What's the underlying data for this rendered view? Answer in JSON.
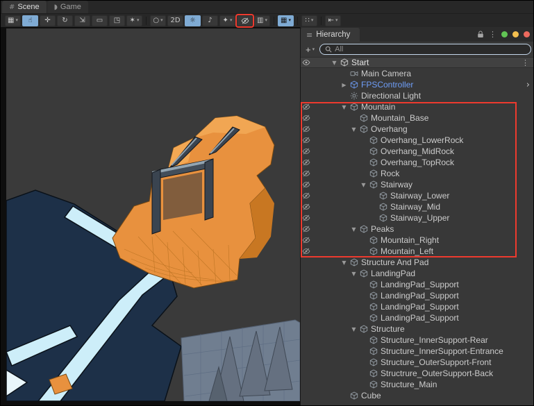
{
  "tabs": [
    {
      "label": "Scene",
      "active": true
    },
    {
      "label": "Game",
      "active": false
    }
  ],
  "scene_toolbar": {
    "buttons": [
      {
        "name": "tool-settings-button",
        "glyph": "▦",
        "dropdown": true
      },
      {
        "name": "view-hand-tool-button",
        "glyph": "☝",
        "active": true
      },
      {
        "name": "move-tool-button",
        "glyph": "✛"
      },
      {
        "name": "rotate-tool-button",
        "glyph": "↻"
      },
      {
        "name": "scale-tool-button",
        "glyph": "⇲"
      },
      {
        "name": "rect-tool-button",
        "glyph": "▭"
      },
      {
        "name": "transform-tool-button",
        "glyph": "◳"
      },
      {
        "name": "custom-tool-button",
        "glyph": "✶",
        "dropdown": true
      },
      {
        "type": "separator"
      },
      {
        "name": "draw-mode-button",
        "glyph": "○",
        "dropdown": true
      },
      {
        "name": "2d-toggle-button",
        "glyph": "2D"
      },
      {
        "name": "lighting-toggle-button",
        "glyph": "☼",
        "active": true
      },
      {
        "name": "audio-toggle-button",
        "glyph": "♪"
      },
      {
        "name": "effects-button",
        "glyph": "✦",
        "dropdown": true
      },
      {
        "name": "scene-visibility-button",
        "icon": "eye-off-icon",
        "red_box": true
      },
      {
        "name": "camera-view-button",
        "glyph": "▥",
        "dropdown": true
      },
      {
        "type": "separator"
      },
      {
        "name": "grid-visibility-button",
        "glyph": "▦",
        "dropdown": true,
        "active": true
      },
      {
        "type": "separator"
      },
      {
        "name": "snap-settings-button",
        "glyph": "∷",
        "dropdown": true
      },
      {
        "type": "separator"
      },
      {
        "name": "overlay-nav-button",
        "glyph": "⇤",
        "dropdown": true
      }
    ]
  },
  "hierarchy": {
    "tab_label": "Hierarchy",
    "add_button_label": "+",
    "search": {
      "placeholder": "All"
    },
    "rows": [
      {
        "label": "Start",
        "level": 0,
        "fold": "open",
        "icon": "unity-scene",
        "eye": true,
        "kebab": true,
        "header": true
      },
      {
        "label": "Main Camera",
        "level": 1,
        "icon": "camera"
      },
      {
        "label": "FPSController",
        "level": 1,
        "fold": "closed",
        "icon": "prefab-cube",
        "prefab": true,
        "expand_arrow": true
      },
      {
        "label": "Directional Light",
        "level": 1,
        "icon": "light"
      },
      {
        "label": "Mountain",
        "level": 1,
        "fold": "open",
        "icon": "cube",
        "hidden": true
      },
      {
        "label": "Mountain_Base",
        "level": 2,
        "icon": "cube",
        "hidden": true
      },
      {
        "label": "Overhang",
        "level": 2,
        "fold": "open",
        "icon": "cube",
        "hidden": true
      },
      {
        "label": "Overhang_LowerRock",
        "level": 3,
        "icon": "cube",
        "hidden": true
      },
      {
        "label": "Overhang_MidRock",
        "level": 3,
        "icon": "cube",
        "hidden": true
      },
      {
        "label": "Overhang_TopRock",
        "level": 3,
        "icon": "cube",
        "hidden": true
      },
      {
        "label": "Rock",
        "level": 3,
        "icon": "cube",
        "hidden": true
      },
      {
        "label": "Stairway",
        "level": 3,
        "fold": "open",
        "icon": "cube",
        "hidden": true
      },
      {
        "label": "Stairway_Lower",
        "level": 4,
        "icon": "cube",
        "hidden": true
      },
      {
        "label": "Stairway_Mid",
        "level": 4,
        "icon": "cube",
        "hidden": true
      },
      {
        "label": "Stairway_Upper",
        "level": 4,
        "icon": "cube",
        "hidden": true
      },
      {
        "label": "Peaks",
        "level": 2,
        "fold": "open",
        "icon": "cube",
        "hidden": true
      },
      {
        "label": "Mountain_Right",
        "level": 3,
        "icon": "cube",
        "hidden": true
      },
      {
        "label": "Mountain_Left",
        "level": 3,
        "icon": "cube",
        "hidden": true
      },
      {
        "label": "Structure And Pad",
        "level": 1,
        "fold": "open",
        "icon": "cube"
      },
      {
        "label": "LandingPad",
        "level": 2,
        "fold": "open",
        "icon": "cube"
      },
      {
        "label": "LandingPad_Support",
        "level": 3,
        "icon": "cube"
      },
      {
        "label": "LandingPad_Support",
        "level": 3,
        "icon": "cube"
      },
      {
        "label": "LandingPad_Support",
        "level": 3,
        "icon": "cube"
      },
      {
        "label": "LandingPad_Support",
        "level": 3,
        "icon": "cube"
      },
      {
        "label": "Structure",
        "level": 2,
        "fold": "open",
        "icon": "cube"
      },
      {
        "label": "Structure_InnerSupport-Rear",
        "level": 3,
        "icon": "cube"
      },
      {
        "label": "Structure_InnerSupport-Entrance",
        "level": 3,
        "icon": "cube"
      },
      {
        "label": "Structure_OuterSupport-Front",
        "level": 3,
        "icon": "cube"
      },
      {
        "label": "Structrure_OuterSupport-Back",
        "level": 3,
        "icon": "cube"
      },
      {
        "label": "Structure_Main",
        "level": 3,
        "icon": "cube"
      },
      {
        "label": "Cube",
        "level": 1,
        "icon": "cube"
      }
    ]
  },
  "colors": {
    "highlight_red": "#ee3a2e",
    "prefab_blue": "#6f9ef8",
    "toolbar_active_blue": "#7fabd4",
    "scene_background": "#3a3a3a",
    "panel_background": "#383838",
    "mountain_orange": "#e8913e",
    "terrain_navy": "#1d3048",
    "walkway_cyan": "#cdeef9",
    "status_dots": [
      "#61c454",
      "#f4bf4f",
      "#ed6a5e"
    ]
  },
  "annotations": {
    "toolbar_red_box_target": "scene-visibility-button",
    "hierarchy_red_box_rows": "Mountain through Mountain_Left"
  }
}
